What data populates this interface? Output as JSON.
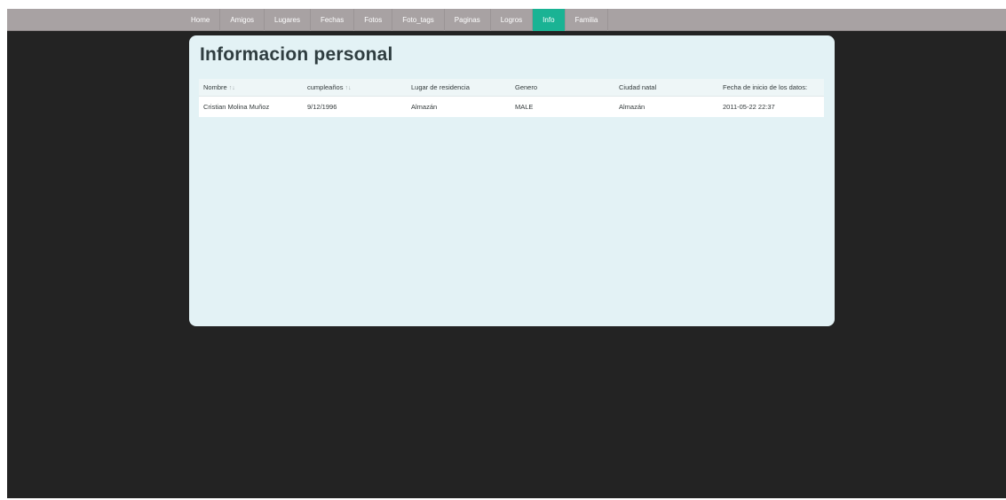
{
  "nav": {
    "items": [
      {
        "label": "Home",
        "active": false
      },
      {
        "label": "Amigos",
        "active": false
      },
      {
        "label": "Lugares",
        "active": false
      },
      {
        "label": "Fechas",
        "active": false
      },
      {
        "label": "Fotos",
        "active": false
      },
      {
        "label": "Foto_tags",
        "active": false
      },
      {
        "label": "Paginas",
        "active": false
      },
      {
        "label": "Logros",
        "active": false
      },
      {
        "label": "Info",
        "active": true
      },
      {
        "label": "Familia",
        "active": false
      }
    ]
  },
  "page": {
    "title": "Informacion personal"
  },
  "table": {
    "columns": [
      {
        "label": "Nombre",
        "sortable": true
      },
      {
        "label": "cumpleaños",
        "sortable": true
      },
      {
        "label": "Lugar de residencia",
        "sortable": false
      },
      {
        "label": "Genero",
        "sortable": false
      },
      {
        "label": "Ciudad natal",
        "sortable": false
      },
      {
        "label": "Fecha de inicio de los datos:",
        "sortable": false
      }
    ],
    "rows": [
      [
        "Cristian Molina Muñoz",
        "9/12/1996",
        "Almazán",
        "MALE",
        "Almazán",
        "2011-05-22 22:37"
      ]
    ]
  },
  "colors": {
    "nav_bg": "#a8a2a3",
    "nav_active": "#1ab394",
    "page_bg": "#232323",
    "panel_bg": "#e3f2f5"
  },
  "icons": {
    "sort": "sort-icon"
  }
}
